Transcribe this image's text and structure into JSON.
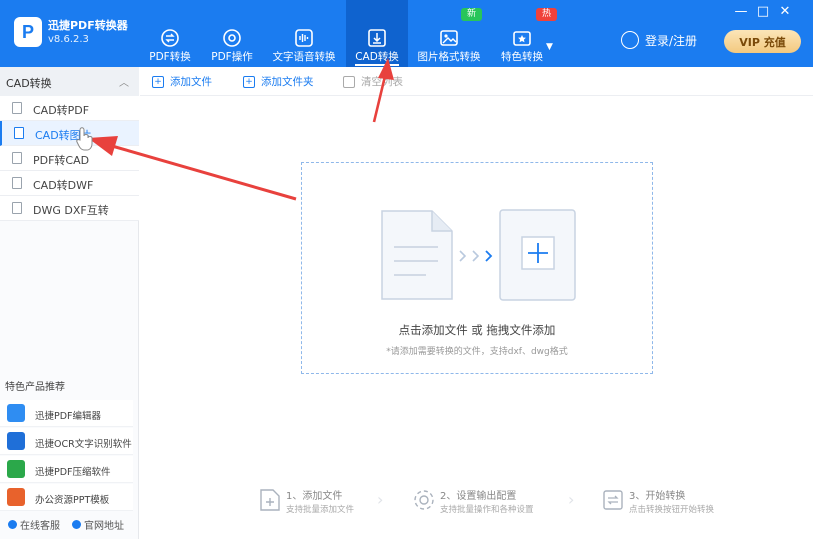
{
  "app": {
    "name": "迅捷PDF转换器",
    "version": "v8.6.2.3",
    "logo_letter": "P"
  },
  "tabs": [
    {
      "label": "PDF转换",
      "icon": "pdf-convert-icon"
    },
    {
      "label": "PDF操作",
      "icon": "pdf-operate-icon"
    },
    {
      "label": "文字语音转换",
      "icon": "audio-wave-icon"
    },
    {
      "label": "CAD转换",
      "icon": "cad-download-icon",
      "active": true
    },
    {
      "label": "图片格式转换",
      "icon": "image-icon"
    },
    {
      "label": "特色转换",
      "icon": "feature-icon"
    }
  ],
  "badges": {
    "new": "新",
    "hot": "热"
  },
  "header": {
    "login": "登录/注册",
    "vip": "VIP 充值"
  },
  "window": {
    "minimize": "—",
    "restore": "□",
    "close": "✕"
  },
  "sidebar": {
    "section_title": "CAD转换",
    "items": [
      {
        "label": "CAD转PDF"
      },
      {
        "label": "CAD转图片",
        "active": true
      },
      {
        "label": "PDF转CAD"
      },
      {
        "label": "CAD转DWF"
      },
      {
        "label": "DWG DXF互转"
      }
    ],
    "featured_title": "特色产品推荐",
    "products": [
      {
        "label": "迅捷PDF编辑器",
        "color": "#2f8df2"
      },
      {
        "label": "迅捷OCR文字识别软件",
        "color": "#1f6fd8"
      },
      {
        "label": "迅捷PDF压缩软件",
        "color": "#2ba84a"
      },
      {
        "label": "办公资源PPT模板",
        "color": "#e8622c"
      }
    ],
    "footer": {
      "service": "在线客服",
      "website": "官网地址"
    }
  },
  "toolbar": {
    "add_file": "添加文件",
    "add_folder": "添加文件夹",
    "clear_list": "清空列表"
  },
  "dropzone": {
    "main_text": "点击添加文件 或 拖拽文件添加",
    "sub_text": "*请添加需要转换的文件，支持dxf、dwg格式"
  },
  "steps": [
    {
      "title": "1、添加文件",
      "desc": "支持批量添加文件"
    },
    {
      "title": "2、设置输出配置",
      "desc": "支持批量操作和各种设置"
    },
    {
      "title": "3、开始转换",
      "desc": "点击转换按钮开始转换"
    }
  ],
  "colors": {
    "primary": "#1b7cf0",
    "annotation": "#e8413d"
  }
}
